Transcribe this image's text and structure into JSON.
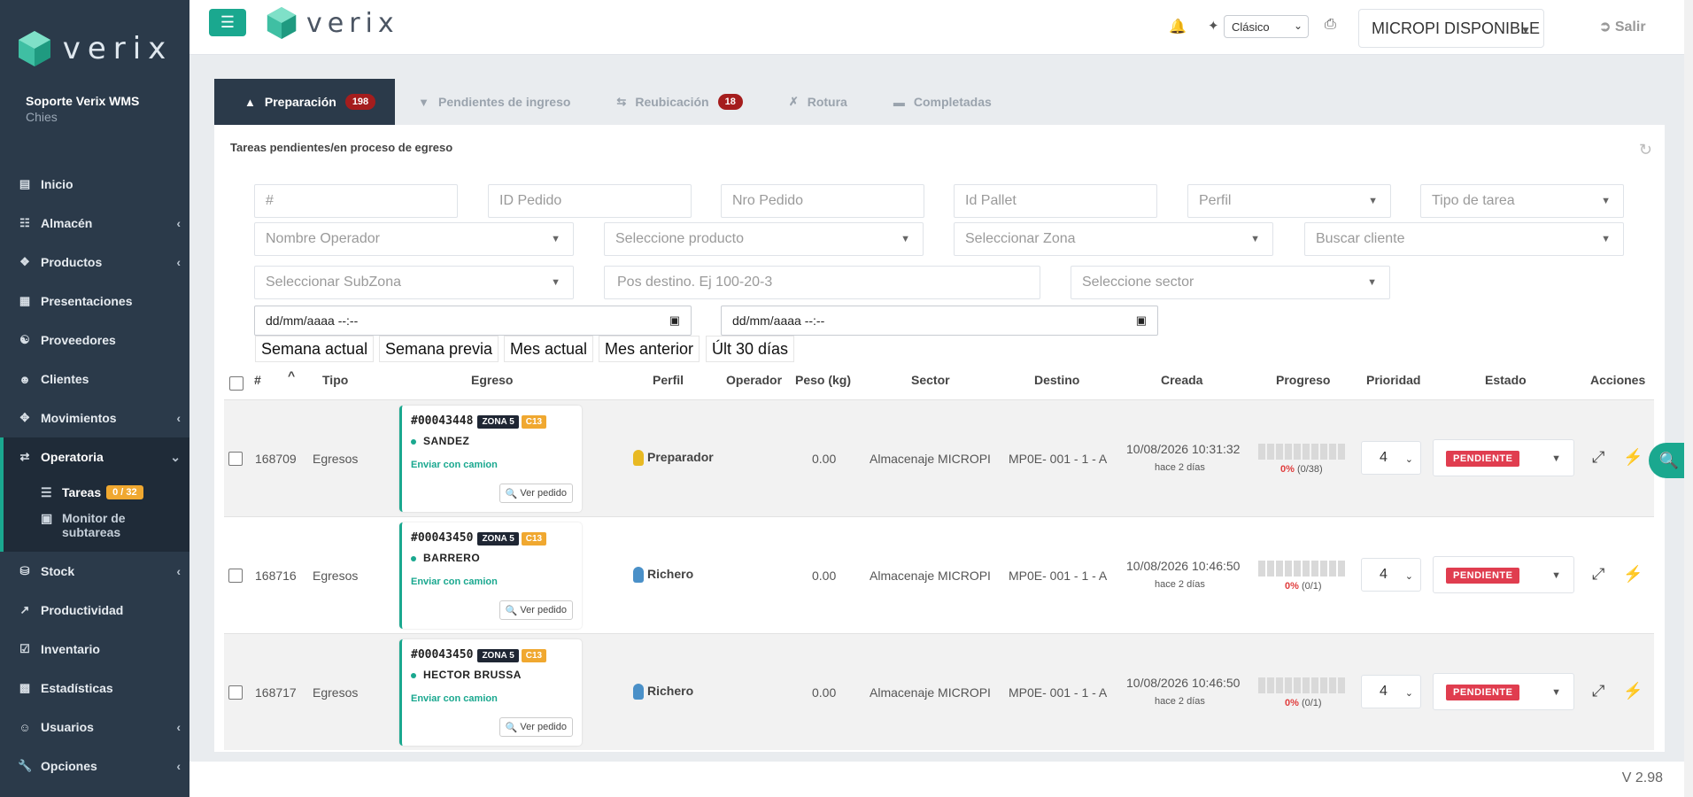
{
  "sidebar": {
    "logo_text": "verix",
    "user_name": "Soporte Verix WMS",
    "user_sub": "Chies",
    "items": [
      {
        "label": "Inicio",
        "icon": "chart-icon",
        "chevron": false
      },
      {
        "label": "Almacén",
        "icon": "sitemap-icon",
        "chevron": true
      },
      {
        "label": "Productos",
        "icon": "cubes-icon",
        "chevron": true
      },
      {
        "label": "Presentaciones",
        "icon": "box-icon",
        "chevron": false
      },
      {
        "label": "Proveedores",
        "icon": "handshake-icon",
        "chevron": false
      },
      {
        "label": "Clientes",
        "icon": "person-icon",
        "chevron": false
      },
      {
        "label": "Movimientos",
        "icon": "arrows-icon",
        "chevron": true
      },
      {
        "label": "Operatoria",
        "icon": "exchange-icon",
        "chevron": true,
        "active": true
      },
      {
        "label": "Stock",
        "icon": "database-icon",
        "chevron": true
      },
      {
        "label": "Productividad",
        "icon": "line-chart-icon",
        "chevron": false
      },
      {
        "label": "Inventario",
        "icon": "check-square-icon",
        "chevron": false
      },
      {
        "label": "Estadísticas",
        "icon": "bar-chart-icon",
        "chevron": false
      },
      {
        "label": "Usuarios",
        "icon": "users-icon",
        "chevron": true
      },
      {
        "label": "Opciones",
        "icon": "wrench-icon",
        "chevron": true
      }
    ],
    "subitems": [
      {
        "label": "Tareas",
        "badge": "0 / 32"
      },
      {
        "label": "Monitor de subtareas"
      }
    ]
  },
  "topbar": {
    "logo_text": "verix",
    "theme_value": "Clásico",
    "warehouse_value": "MICROPI DISPONIBLE",
    "logout_label": "Salir"
  },
  "tabs": [
    {
      "label": "Preparación",
      "badge": "198",
      "active": true
    },
    {
      "label": "Pendientes de ingreso"
    },
    {
      "label": "Reubicación",
      "badge": "18"
    },
    {
      "label": "Rotura"
    },
    {
      "label": "Completadas"
    }
  ],
  "panel_title": "Tareas pendientes/en proceso de egreso",
  "filters": {
    "hash": "#",
    "id_pedido": "ID Pedido",
    "nro_pedido": "Nro Pedido",
    "id_pallet": "Id Pallet",
    "perfil": "Perfil",
    "tipo_tarea": "Tipo de tarea",
    "operador": "Nombre Operador",
    "producto": "Seleccione producto",
    "zona": "Seleccionar Zona",
    "cliente": "Buscar cliente",
    "subzona": "Seleccionar SubZona",
    "pos_destino": "Pos destino. Ej 100-20-3",
    "sector": "Seleccione sector",
    "date_from": "dd/mm/aaaa --:--",
    "date_to": "dd/mm/aaaa --:--"
  },
  "quick_ranges": [
    "Semana actual",
    "Semana previa",
    "Mes actual",
    "Mes anterior",
    "Últ 30 días"
  ],
  "columns": [
    "#",
    "Tipo",
    "Egreso",
    "Perfil",
    "Operador",
    "Peso (kg)",
    "Sector",
    "Destino",
    "Creada",
    "Progreso",
    "Prioridad",
    "Estado",
    "Acciones"
  ],
  "rows": [
    {
      "id": "168709",
      "tipo": "Egresos",
      "order": "#00043448",
      "zona": "ZONA 5",
      "code": "C13",
      "cliente": "SANDEZ",
      "ship": "Enviar con camion",
      "ver": "Ver pedido",
      "perfil": "Preparador",
      "peso": "0.00",
      "sector": "Almacenaje MICROPI",
      "destino": "MP0E- 001 - 1 - A",
      "creada": "10/08/2026 10:31:32",
      "hace": "hace 2 días",
      "pct": "0%",
      "count": "(0/38)",
      "progress": 0,
      "prioridad": "4",
      "estado": "PENDIENTE",
      "perfil_color": "#e8b923"
    },
    {
      "id": "168716",
      "tipo": "Egresos",
      "order": "#00043450",
      "zona": "ZONA 5",
      "code": "C13",
      "cliente": "BARRERO",
      "ship": "Enviar con camion",
      "ver": "Ver pedido",
      "perfil": "Richero",
      "peso": "0.00",
      "sector": "Almacenaje MICROPI",
      "destino": "MP0E- 001 - 1 - A",
      "creada": "10/08/2026 10:46:50",
      "hace": "hace 2 días",
      "pct": "0%",
      "count": "(0/1)",
      "progress": 0,
      "prioridad": "4",
      "estado": "PENDIENTE",
      "perfil_color": "#4a90c8"
    },
    {
      "id": "168717",
      "tipo": "Egresos",
      "order": "#00043450",
      "zona": "ZONA 5",
      "code": "C13",
      "cliente": "HECTOR BRUSSA",
      "ship": "Enviar con camion",
      "ver": "Ver pedido",
      "perfil": "Richero",
      "peso": "0.00",
      "sector": "Almacenaje MICROPI",
      "destino": "MP0E- 001 - 1 - A",
      "creada": "10/08/2026 10:46:50",
      "hace": "hace 2 días",
      "pct": "0%",
      "count": "(0/1)",
      "progress": 0,
      "prioridad": "4",
      "estado": "PENDIENTE",
      "perfil_color": "#4a90c8"
    }
  ],
  "footer": {
    "version": "V 2.98"
  },
  "colors": {
    "accent": "#1aa88f",
    "sidebar": "#2b3a4a",
    "danger": "#e03d4f",
    "badge_red": "#a51d1d",
    "badge_orange": "#f0a830"
  }
}
